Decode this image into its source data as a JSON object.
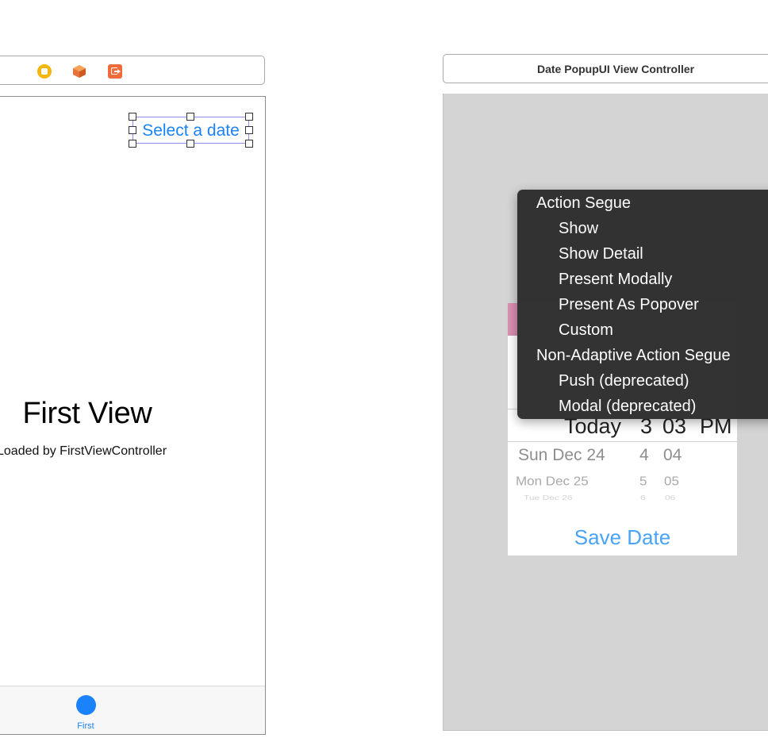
{
  "left_scene": {
    "select_date_label": "Select a date",
    "title": "First View",
    "subtitle": "Loaded by FirstViewController",
    "tab_label": "First"
  },
  "right_scene": {
    "title": "Date PopupUI View Controller",
    "picker": {
      "selected": {
        "day": "Today",
        "hour": "3",
        "minute": "03",
        "ampm": "PM"
      },
      "row1": {
        "day": "Sun Dec 24",
        "hour": "4",
        "minute": "04"
      },
      "row2": {
        "day": "Mon Dec 25",
        "hour": "5",
        "minute": "05"
      },
      "row3": {
        "day": "Tue Dec 26",
        "hour": "6",
        "minute": "06"
      }
    },
    "save_label": "Save Date"
  },
  "context_menu": {
    "groups": [
      {
        "header": "Action Segue",
        "items": [
          "Show",
          "Show Detail",
          "Present Modally",
          "Present As Popover",
          "Custom"
        ]
      },
      {
        "header": "Non-Adaptive Action Segue",
        "items": [
          "Push (deprecated)",
          "Modal (deprecated)"
        ]
      }
    ]
  },
  "colors": {
    "accent_blue": "#1a82fb",
    "save_blue": "#4aa3f4",
    "menu_bg": "#2f2f2f",
    "vc_icon": "#f5b70f",
    "exit_icon": "#f06a3a"
  }
}
